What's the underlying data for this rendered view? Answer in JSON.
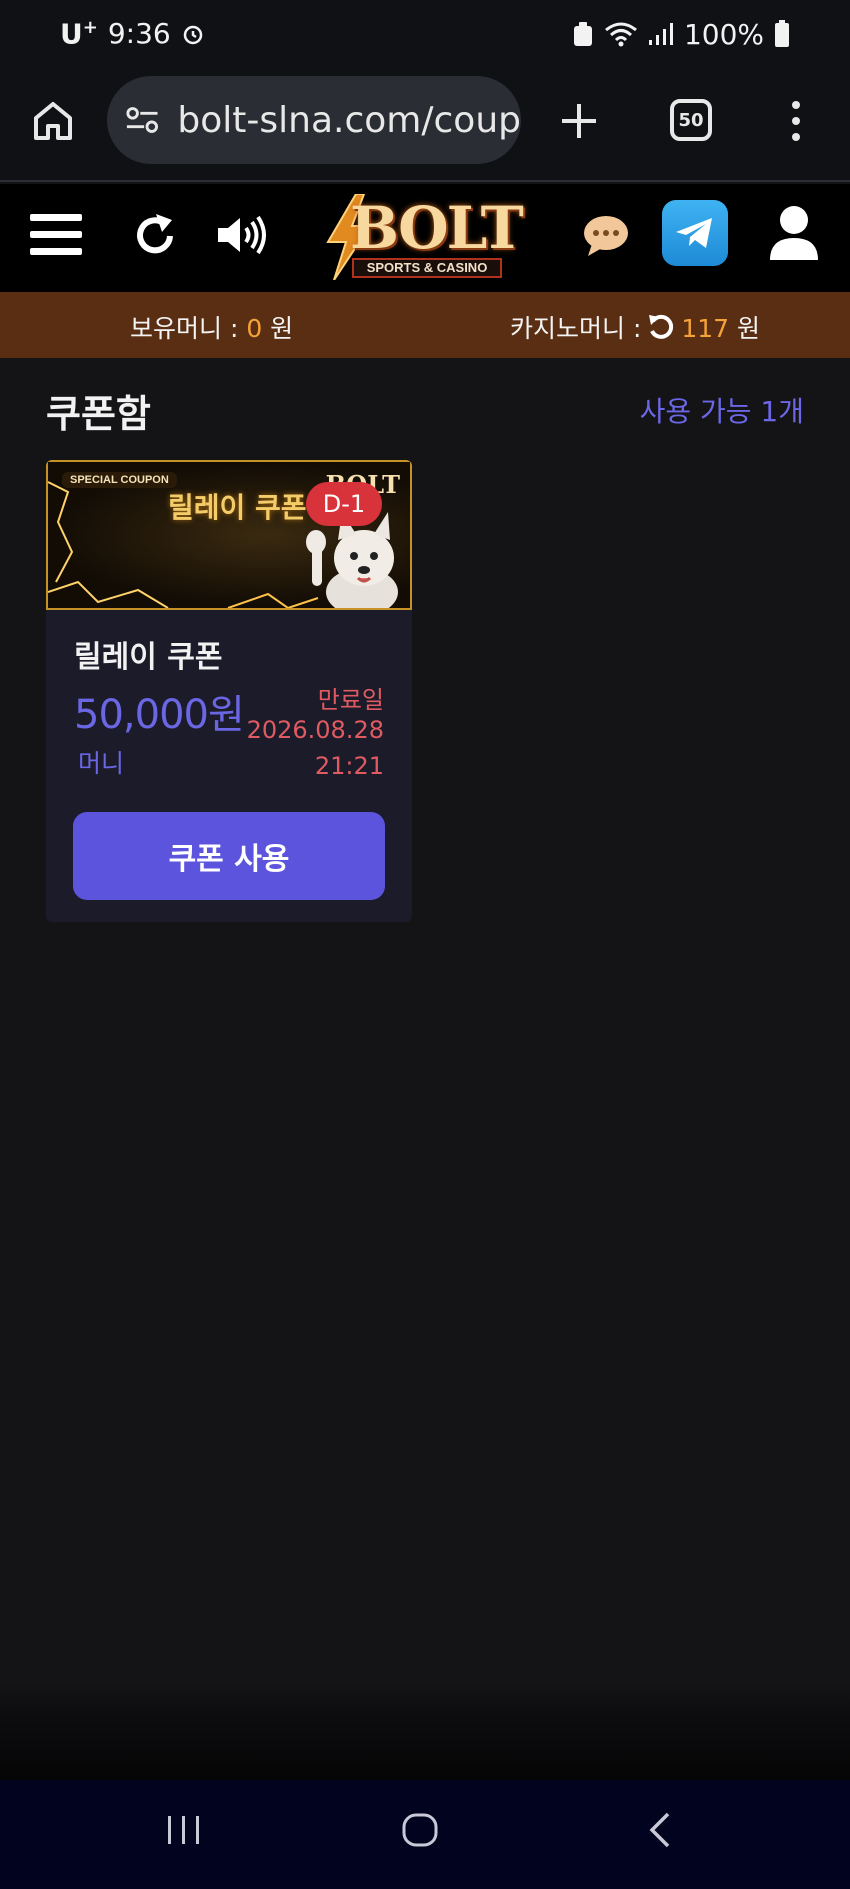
{
  "status_bar": {
    "carrier": "U",
    "time": "9:36",
    "battery": "100%"
  },
  "browser": {
    "url": "bolt-slna.com/coup",
    "tab_count": "50"
  },
  "header": {
    "logo_text": "BOLT",
    "logo_sub": "SPORTS & CASINO"
  },
  "money": {
    "holding_label": "보유머니 : ",
    "holding_value": "0",
    "holding_unit": " 원",
    "casino_label": "카지노머니 : ",
    "casino_value": "117",
    "casino_unit": " 원"
  },
  "page": {
    "title": "쿠폰함",
    "available": "사용 가능 1개"
  },
  "coupon": {
    "banner_special": "SPECIAL COUPON",
    "banner_title": "릴레이 쿠폰",
    "banner_brand": "BOLT",
    "dday": "D-1",
    "name": "릴레이 쿠폰",
    "amount": "50,000원",
    "unit": "머니",
    "expiry_label": "만료일",
    "expiry_date": "2026.08.28",
    "expiry_time": "21:21",
    "use_button": "쿠폰 사용"
  },
  "colors": {
    "accent": "#5c54dc",
    "money_bar": "#5a2e12",
    "amount_highlight": "#f6a23b",
    "expiry": "#e05a62"
  }
}
